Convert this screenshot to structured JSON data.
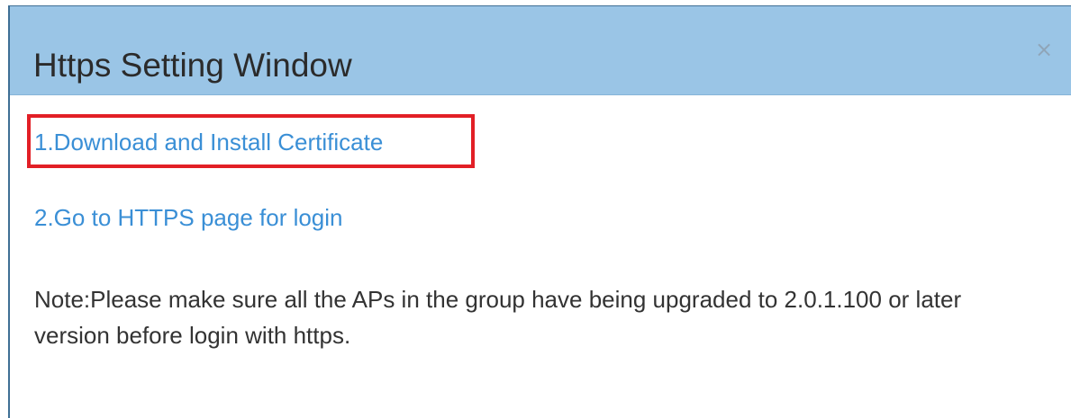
{
  "dialog": {
    "title": "Https Setting Window",
    "close_symbol": "×",
    "close_icon": "close-icon",
    "links": [
      {
        "label": "1.Download and Install Certificate",
        "highlighted": true
      },
      {
        "label": "2.Go to HTTPS page for login",
        "highlighted": false
      }
    ],
    "note": "Note:Please make sure all the APs in the group have being upgraded to 2.0.1.100 or later version before login with https."
  },
  "colors": {
    "header_bg": "#9ac5e6",
    "link": "#3a8fd6",
    "highlight_border": "#e21f26",
    "text": "#333333"
  }
}
